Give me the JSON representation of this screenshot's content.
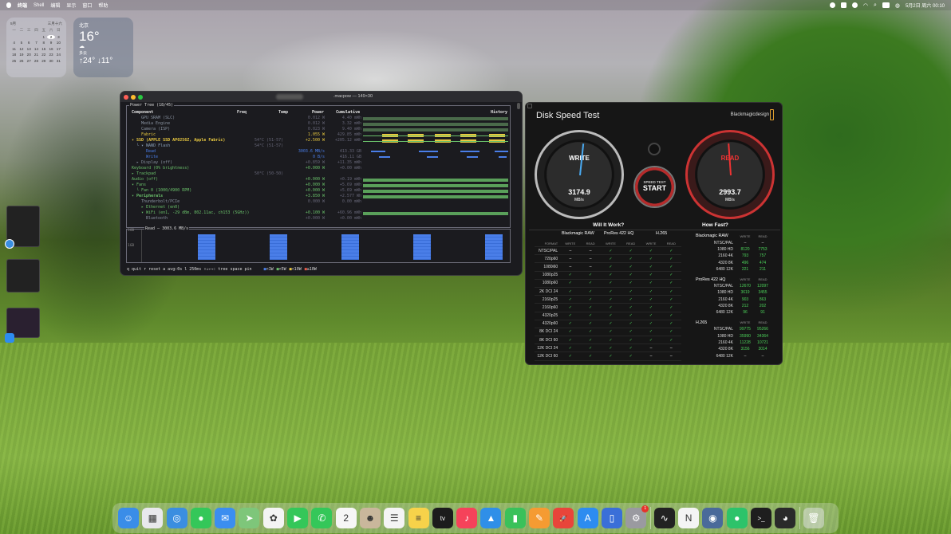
{
  "menubar": {
    "items": [
      "Shell",
      "编辑",
      "显示",
      "窗口",
      "帮助"
    ],
    "first_item": "终端",
    "datetime": "5月2日 周六 00:10"
  },
  "calendar": {
    "month": "5月",
    "lunar": "三月十六",
    "weekdays": [
      "一",
      "二",
      "三",
      "四",
      "五",
      "六",
      "日"
    ],
    "rows": [
      [
        "",
        "",
        "",
        "",
        "1",
        "2",
        "3"
      ],
      [
        "4",
        "5",
        "6",
        "7",
        "8",
        "9",
        "10"
      ],
      [
        "11",
        "12",
        "13",
        "14",
        "15",
        "16",
        "17"
      ],
      [
        "18",
        "19",
        "20",
        "21",
        "22",
        "23",
        "24"
      ],
      [
        "25",
        "26",
        "27",
        "28",
        "29",
        "30",
        "31"
      ]
    ],
    "today": "2"
  },
  "weather": {
    "city": "北京",
    "temp": "16°",
    "condition": "多云",
    "hi": "↑24°",
    "lo": "↓11°"
  },
  "terminal": {
    "title_suffix": ".macpow — 149×30",
    "pane_title": "Power Tree (18/45)",
    "columns": {
      "component": "Component",
      "freq": "Freq",
      "temp": "Temp",
      "power": "Power",
      "cumulative": "Cumulative",
      "history": "History"
    },
    "rows": [
      {
        "name": "GPU SRAM (SLC)",
        "indent": 2,
        "temp": "",
        "power": "0.012 W",
        "cum": "4.40 mWh",
        "color": "#6a7a8a",
        "dim": true
      },
      {
        "name": "Media Engine",
        "indent": 2,
        "temp": "",
        "power": "0.012 W",
        "cum": "3.32 mWh",
        "color": "#8aa0b8",
        "dim": true
      },
      {
        "name": "Camera (ISP)",
        "indent": 2,
        "temp": "",
        "power": "0.023 W",
        "cum": "9.40 mWh",
        "color": "#8aa0b8",
        "dim": true
      },
      {
        "name": "Fabric",
        "indent": 2,
        "temp": "",
        "power": "1.055 W",
        "cum": "429.85 mWh",
        "color": "#e8c840",
        "dim": false
      },
      {
        "name": "▾ SSD (APPLE SSD AP0256Z, Apple Fabric)",
        "indent": 0,
        "temp": "54°C (51-57)",
        "power": "+2.500 W",
        "cum": "+205.12 mWh",
        "color": "#e8c840",
        "dim": false,
        "bold": true
      },
      {
        "name": "└ ▾ NAND Flash",
        "indent": 1,
        "temp": "54°C (51-57)",
        "power": "",
        "cum": "",
        "color": "#8aa0b8",
        "dim": false
      },
      {
        "name": "Read",
        "indent": 3,
        "temp": "",
        "power": "3003.6 MB/s",
        "cum": "413.33 GB",
        "color": "#4a7ee8",
        "dim": false
      },
      {
        "name": "Write",
        "indent": 3,
        "temp": "",
        "power": "0 B/s",
        "cum": "416.11 GB",
        "color": "#4a7ee8",
        "dim": false
      },
      {
        "name": "▸ Display (off)",
        "indent": 1,
        "temp": "",
        "power": "+0.859 W",
        "cum": "+11.35 mWh",
        "color": "#556",
        "dim": true
      },
      {
        "name": "Keyboard (0% brightness)",
        "indent": 0,
        "temp": "",
        "power": "+0.000 W",
        "cum": "+0.00 mWh",
        "color": "#6ac06a",
        "dim": false
      },
      {
        "name": "▸ Trackpad",
        "indent": 0,
        "temp": "50°C (50-50)",
        "power": "",
        "cum": "",
        "color": "#6ac06a",
        "dim": false
      },
      {
        "name": "Audio (off)",
        "indent": 0,
        "temp": "",
        "power": "+0.000 W",
        "cum": "+0.19 mWh",
        "color": "#6ac06a",
        "dim": false
      },
      {
        "name": "▾ Fans",
        "indent": 0,
        "temp": "",
        "power": "+0.000 W",
        "cum": "+5.69 mWh",
        "color": "#6ac06a",
        "dim": false
      },
      {
        "name": "└ Fan 0 (1000/4900 RPM)",
        "indent": 1,
        "temp": "",
        "power": "+0.000 W",
        "cum": "+5.69 mWh",
        "color": "#6ac06a",
        "dim": false
      },
      {
        "name": "▾ Peripherals",
        "indent": 0,
        "temp": "",
        "power": "+3.850 W",
        "cum": "+2.577 Wh",
        "color": "#6ac06a",
        "dim": false,
        "bold": true
      },
      {
        "name": "Thunderbolt/PCIe",
        "indent": 2,
        "temp": "",
        "power": "0.000 W",
        "cum": "0.00 mWh",
        "color": "#5a8a5a",
        "dim": true
      },
      {
        "name": "▸ Ethernet (en0)",
        "indent": 2,
        "temp": "",
        "power": "",
        "cum": "",
        "color": "#6ac06a",
        "dim": false
      },
      {
        "name": "▾ WiFi (en1, -29 dBm, 802.11ac, ch153 (5GHz))",
        "indent": 2,
        "temp": "",
        "power": "+0.100 W",
        "cum": "+60.96 mWh",
        "color": "#6ac06a",
        "dim": false
      },
      {
        "name": "Bluetooth",
        "indent": 3,
        "temp": "",
        "power": "+0.000 W",
        "cum": "+0.00 mWh",
        "color": "#5a8a5a",
        "dim": true
      }
    ],
    "read_pane": {
      "title": "Read — 3003.6 MB/s",
      "y_labels": [
        "3GB",
        "1GB"
      ],
      "bursts": [
        0.95,
        0.95,
        0.95,
        0.95,
        0.95
      ]
    },
    "status": "q quit  r reset  a avg:0s  l 250ms  ↑↓←→: tree  space pin",
    "legend": [
      {
        "label": "<1W",
        "color": "#4a7ee8"
      },
      {
        "label": "<5W",
        "color": "#6ac06a"
      },
      {
        "label": "<10W",
        "color": "#e8c840"
      },
      {
        "label": "≥10W",
        "color": "#e85a4a"
      }
    ]
  },
  "disk_speed": {
    "title": "Disk Speed Test",
    "brand": "Blackmagicdesign",
    "write_label": "WRITE",
    "read_label": "READ",
    "write_value": "3174.9",
    "read_value": "2993.7",
    "unit": "MB/s",
    "start_top": "SPEED TEST",
    "start_main": "START",
    "will_it_work": "Will It Work?",
    "how_fast": "How Fast?",
    "codec_groups": [
      "Blackmagic RAW",
      "ProRes 422 HQ",
      "H.265"
    ],
    "subcols": [
      "FORMAT",
      "WRITE",
      "READ",
      "WRITE",
      "READ",
      "WRITE",
      "READ"
    ],
    "formats": [
      {
        "f": "NTSC/PAL",
        "v": [
          "–",
          "–",
          "✓",
          "✓",
          "✓",
          "✓"
        ]
      },
      {
        "f": "720p60",
        "v": [
          "–",
          "–",
          "✓",
          "✓",
          "✓",
          "✓"
        ]
      },
      {
        "f": "1080i60",
        "v": [
          "–",
          "–",
          "✓",
          "✓",
          "✓",
          "✓"
        ]
      },
      {
        "f": "1080p25",
        "v": [
          "✓",
          "✓",
          "✓",
          "✓",
          "✓",
          "✓"
        ]
      },
      {
        "f": "1080p60",
        "v": [
          "✓",
          "✓",
          "✓",
          "✓",
          "✓",
          "✓"
        ]
      },
      {
        "f": "2K DCI 24",
        "v": [
          "✓",
          "✓",
          "✓",
          "✓",
          "✓",
          "✓"
        ]
      },
      {
        "f": "2160p25",
        "v": [
          "✓",
          "✓",
          "✓",
          "✓",
          "✓",
          "✓"
        ]
      },
      {
        "f": "2160p60",
        "v": [
          "✓",
          "✓",
          "✓",
          "✓",
          "✓",
          "✓"
        ]
      },
      {
        "f": "4320p25",
        "v": [
          "✓",
          "✓",
          "✓",
          "✓",
          "✓",
          "✓"
        ]
      },
      {
        "f": "4320p60",
        "v": [
          "✓",
          "✓",
          "✓",
          "✓",
          "✓",
          "✓"
        ]
      },
      {
        "f": "8K DCI 24",
        "v": [
          "✓",
          "✓",
          "✓",
          "✓",
          "✓",
          "✓"
        ]
      },
      {
        "f": "8K DCI 60",
        "v": [
          "✓",
          "✓",
          "✓",
          "✓",
          "✓",
          "✓"
        ]
      },
      {
        "f": "12K DCI 24",
        "v": [
          "✓",
          "✓",
          "✓",
          "✓",
          "–",
          "–"
        ]
      },
      {
        "f": "12K DCI 60",
        "v": [
          "✓",
          "✓",
          "✓",
          "✓",
          "–",
          "–"
        ]
      }
    ],
    "how_fast_groups": [
      {
        "name": "Blackmagic RAW",
        "rows": [
          {
            "f": "NTSC/PAL",
            "w": "–",
            "r": "–"
          },
          {
            "f": "1080 HD",
            "w": "8120",
            "r": "7753"
          },
          {
            "f": "2160 4K",
            "w": "793",
            "r": "757"
          },
          {
            "f": "4320 8K",
            "w": "496",
            "r": "474"
          },
          {
            "f": "6480 12K",
            "w": "221",
            "r": "211"
          }
        ]
      },
      {
        "name": "ProRes 422 HQ",
        "rows": [
          {
            "f": "NTSC/PAL",
            "w": "12670",
            "r": "12097"
          },
          {
            "f": "1080 HD",
            "w": "3619",
            "r": "3455"
          },
          {
            "f": "2160 4K",
            "w": "903",
            "r": "863"
          },
          {
            "f": "4320 8K",
            "w": "212",
            "r": "202"
          },
          {
            "f": "6480 12K",
            "w": "96",
            "r": "91"
          }
        ]
      },
      {
        "name": "H.265",
        "rows": [
          {
            "f": "NTSC/PAL",
            "w": "99775",
            "r": "95266"
          },
          {
            "f": "1080 HD",
            "w": "35990",
            "r": "34364"
          },
          {
            "f": "2160 4K",
            "w": "11228",
            "r": "10721"
          },
          {
            "f": "4320 8K",
            "w": "3156",
            "r": "3014"
          },
          {
            "f": "6480 12K",
            "w": "–",
            "r": "–"
          }
        ]
      }
    ],
    "write_col": "WRITE",
    "read_col": "READ"
  },
  "dock": {
    "apps": [
      {
        "name": "finder",
        "color": "#3a8de8",
        "glyph": "☺"
      },
      {
        "name": "launchpad",
        "color": "#e8e8ec",
        "glyph": "▦"
      },
      {
        "name": "safari",
        "color": "#3a8ee0",
        "glyph": "◎"
      },
      {
        "name": "messages",
        "color": "#34c759",
        "glyph": "●"
      },
      {
        "name": "mail",
        "color": "#3b8ef0",
        "glyph": "✉"
      },
      {
        "name": "maps",
        "color": "#7ec67a",
        "glyph": "➤"
      },
      {
        "name": "photos",
        "color": "#f4f4f4",
        "glyph": "✿"
      },
      {
        "name": "facetime",
        "color": "#34c759",
        "glyph": "▶"
      },
      {
        "name": "phone",
        "color": "#34c759",
        "glyph": "✆"
      },
      {
        "name": "calendar",
        "color": "#f6f6f6",
        "glyph": "2"
      },
      {
        "name": "contacts",
        "color": "#c9b79c",
        "glyph": "☻"
      },
      {
        "name": "reminders",
        "color": "#f4f4f4",
        "glyph": "☰"
      },
      {
        "name": "notes",
        "color": "#f7d24a",
        "glyph": "≡"
      },
      {
        "name": "tv",
        "color": "#1c1c1c",
        "glyph": "tv"
      },
      {
        "name": "music",
        "color": "#f5425a",
        "glyph": "♪"
      },
      {
        "name": "keynote",
        "color": "#2f8fe8",
        "glyph": "▲"
      },
      {
        "name": "numbers",
        "color": "#3ac15a",
        "glyph": "▮"
      },
      {
        "name": "pages",
        "color": "#f59b32",
        "glyph": "✎"
      },
      {
        "name": "rocket",
        "color": "#e8453a",
        "glyph": "🚀"
      },
      {
        "name": "app-store",
        "color": "#2d8cf0",
        "glyph": "A"
      },
      {
        "name": "preview",
        "color": "#3a6fd8",
        "glyph": "▯"
      },
      {
        "name": "system-settings",
        "color": "#9a9aa0",
        "glyph": "⚙",
        "badge": "1"
      },
      {
        "name": "activity-monitor",
        "color": "#222",
        "glyph": "∿"
      },
      {
        "name": "notion",
        "color": "#f4f4f4",
        "glyph": "N"
      },
      {
        "name": "disk-utility",
        "color": "#4a6a9a",
        "glyph": "◉"
      },
      {
        "name": "wechat",
        "color": "#2dc36a",
        "glyph": "●"
      },
      {
        "name": "terminal",
        "color": "#1e1e1e",
        "glyph": ">_"
      },
      {
        "name": "disk-speed-test",
        "color": "#2a2a2a",
        "glyph": "◕"
      }
    ],
    "trash": {
      "name": "trash",
      "glyph": "🗑"
    }
  }
}
